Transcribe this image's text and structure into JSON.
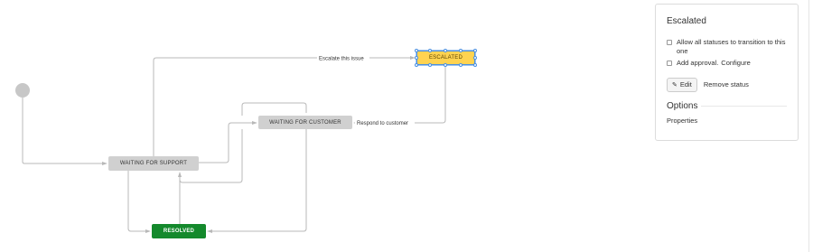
{
  "diagram": {
    "statuses": {
      "waiting_for_support": "WAITING FOR SUPPORT",
      "waiting_for_customer": "WAITING FOR CUSTOMER",
      "resolved": "RESOLVED",
      "escalated": "ESCALATED"
    },
    "transitions": {
      "escalate": "Escalate this issue",
      "respond": "Respond to customer"
    },
    "colors": {
      "status_gray": "#d0d0d0",
      "resolved_green": "#14892c",
      "escalated_yellow": "#ffd351",
      "selection_blue": "#4a90e2",
      "connector_gray": "#b8b8b8"
    }
  },
  "panel": {
    "title": "Escalated",
    "allow_all_label": "Allow all statuses to transition to this one",
    "allow_all_checked": false,
    "add_approval_label": "Add approval.",
    "configure_label": "Configure",
    "add_approval_checked": false,
    "edit_label": "Edit",
    "edit_icon": "pencil-icon",
    "remove_label": "Remove status",
    "options_heading": "Options",
    "properties_label": "Properties"
  }
}
